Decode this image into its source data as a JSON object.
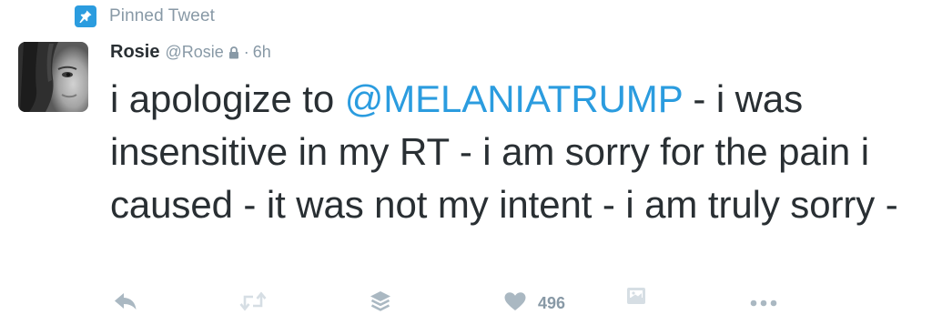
{
  "pinned": {
    "label": "Pinned Tweet",
    "icon": "pin-icon"
  },
  "tweet": {
    "author_name": "Rosie",
    "author_handle": "@Rosie",
    "protected_icon": "lock-icon",
    "separator": "·",
    "time": "6h",
    "text_before": "i apologize to ",
    "mention": "@MELANIATRUMP",
    "text_after": " - i was insensitive in my RT - i am sorry for the pain i caused - it was not my intent - i am truly sorry -"
  },
  "actions": {
    "reply_icon": "reply-icon",
    "retweet_icon": "retweet-icon",
    "buffer_icon": "buffer-stack-icon",
    "like_icon": "heart-icon",
    "like_count": "496",
    "extension_icon": "gallery-icon",
    "more_icon": "more-dots-icon"
  },
  "colors": {
    "accent": "#2b9cdf",
    "text": "#292f33",
    "muted": "#8899a6",
    "icon": "#aab8c2"
  }
}
